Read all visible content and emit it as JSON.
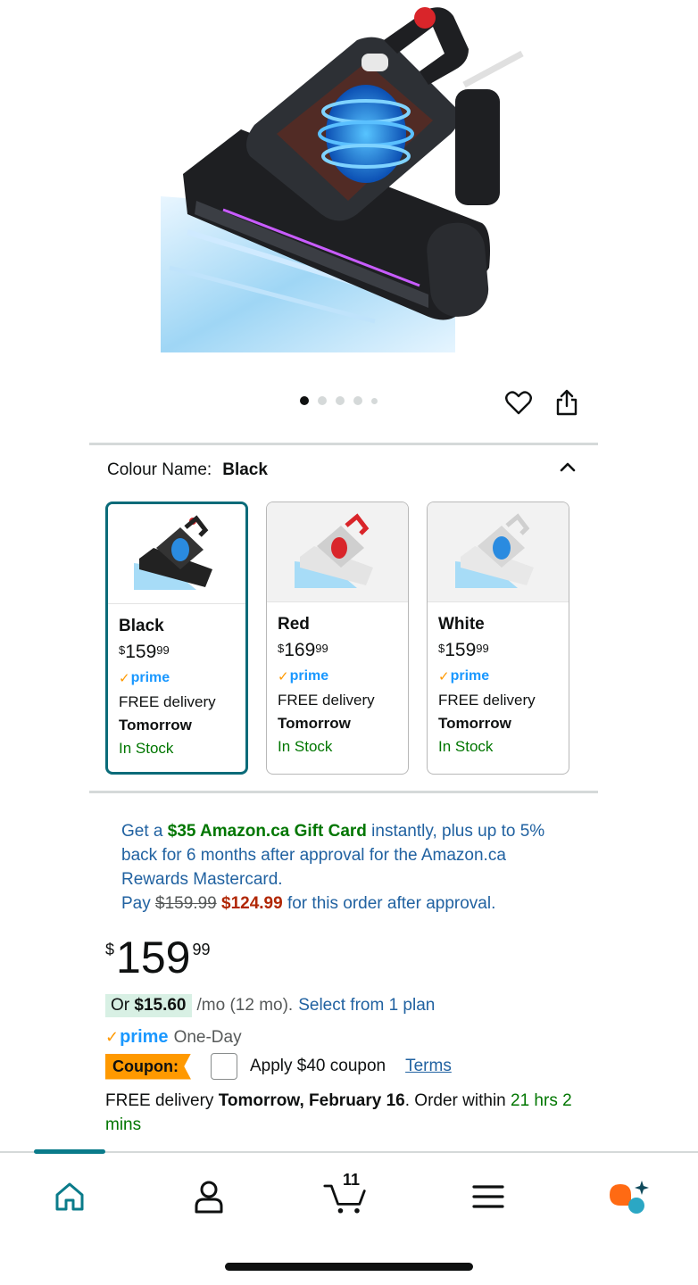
{
  "hero": {
    "image_alt": "Vacuum cleaner product image",
    "dot_count": 5,
    "active_dot": 0
  },
  "colour": {
    "label": "Colour Name:",
    "value": "Black"
  },
  "swatches": [
    {
      "name": "Black",
      "currency": "$",
      "whole": "159",
      "cents": "99",
      "prime": "prime",
      "delivery": "FREE delivery",
      "when": "Tomorrow",
      "stock": "In Stock",
      "selected": true
    },
    {
      "name": "Red",
      "currency": "$",
      "whole": "169",
      "cents": "99",
      "prime": "prime",
      "delivery": "FREE delivery",
      "when": "Tomorrow",
      "stock": "In Stock",
      "selected": false
    },
    {
      "name": "White",
      "currency": "$",
      "whole": "159",
      "cents": "99",
      "prime": "prime",
      "delivery": "FREE delivery",
      "when": "Tomorrow",
      "stock": "In Stock",
      "selected": false
    }
  ],
  "promo": {
    "p1": "Get a ",
    "gift": "$35 Amazon.ca Gift Card",
    "p2": " instantly, plus up to 5% back for 6 months after approval for the Amazon.ca Rewards Mastercard.",
    "pay": "Pay ",
    "old_price": "$159.99",
    "new_price": "$124.99",
    "p3": " for this order after approval."
  },
  "price": {
    "currency": "$",
    "whole": "159",
    "cents": "99"
  },
  "installment": {
    "or": "Or ",
    "amount": "$15.60",
    "per": "/mo (12 mo).",
    "link": "Select from 1 plan"
  },
  "prime_line": {
    "prime": "prime",
    "speed": "One-Day"
  },
  "coupon": {
    "badge": "Coupon:",
    "label": "Apply $40 coupon",
    "terms": "Terms"
  },
  "delivery": {
    "free": "FREE delivery ",
    "date": "Tomorrow, February 16",
    "order": ". Order within ",
    "countdown": "21 hrs 2 mins"
  },
  "nav": {
    "cart_count": "11"
  },
  "colors": {
    "accent": "#0a7b8a",
    "link": "#2162a1",
    "green": "#007600",
    "price_red": "#b12704",
    "prime_blue": "#1a98ff",
    "coupon_orange": "#ff9900"
  }
}
